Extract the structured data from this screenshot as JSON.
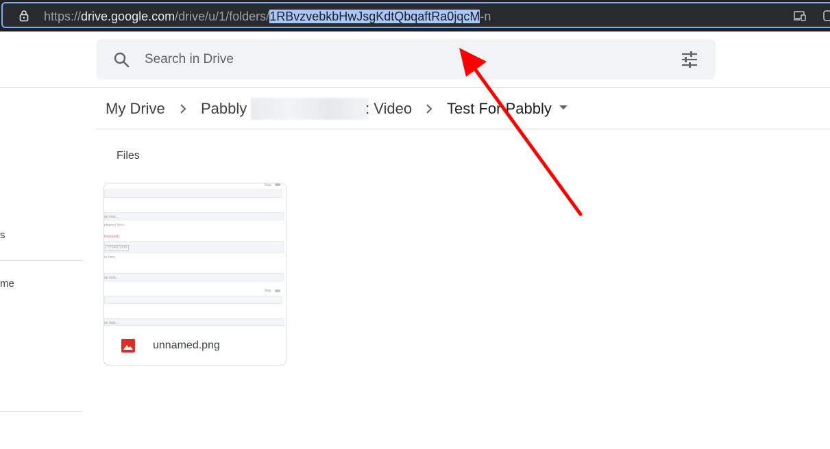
{
  "browser": {
    "url_prefix": "https://",
    "url_host": "drive.google.com",
    "url_path": "/drive/u/1/folders/",
    "url_selected": "1RBvzvebkbHwJsgKdtQbqaftRa0jqcM",
    "url_suffix": "-n"
  },
  "sidebar": {
    "fragment_1": "s",
    "fragment_2": "me"
  },
  "search": {
    "placeholder": "Search in Drive"
  },
  "breadcrumb": {
    "items": [
      "My Drive",
      "Pabbly",
      ": Video",
      "Test For Pabbly"
    ]
  },
  "content": {
    "section_label": "Files",
    "files": [
      {
        "name": "unnamed.png",
        "thumb_texts": [
          "Map",
          "ap data...",
          "ployees here.",
          "Required)",
          "8704601000",
          "re here.",
          "ap data...",
          "Map",
          "ap data..."
        ]
      }
    ]
  },
  "colors": {
    "accent": "#7cacf8",
    "image_icon": "#d93025",
    "arrow": "#ff0000"
  }
}
